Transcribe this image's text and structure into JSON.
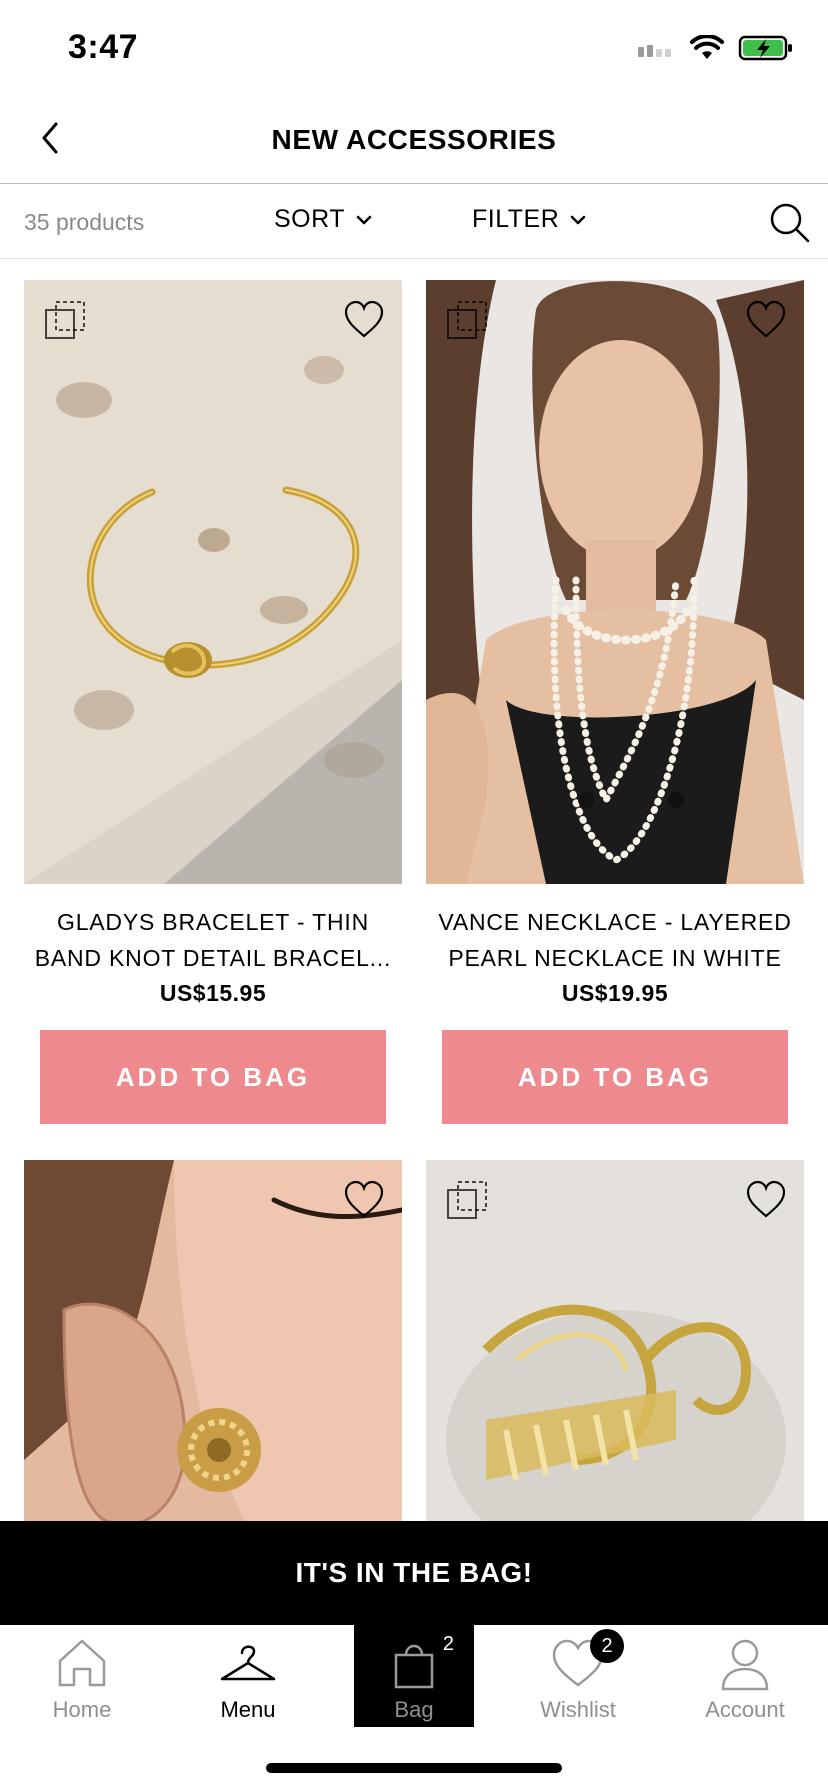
{
  "status_bar": {
    "time": "3:47"
  },
  "header": {
    "title": "NEW ACCESSORIES"
  },
  "toolbar": {
    "count": "35 products",
    "sort_label": "SORT",
    "filter_label": "FILTER"
  },
  "products": [
    {
      "name": "GLADYS BRACELET - THIN BAND KNOT DETAIL BRACEL...",
      "price": "US$15.95",
      "button": "ADD TO BAG"
    },
    {
      "name": "VANCE NECKLACE - LAYERED PEARL NECKLACE IN WHITE",
      "price": "US$19.95",
      "button": "ADD TO BAG"
    },
    {
      "name": "",
      "price": "",
      "button": ""
    },
    {
      "name": "",
      "price": "",
      "button": ""
    }
  ],
  "banner": {
    "text": "IT'S IN THE BAG!"
  },
  "nav": {
    "home": "Home",
    "menu": "Menu",
    "bag": "Bag",
    "bag_count": "2",
    "wishlist": "Wishlist",
    "wishlist_count": "2",
    "account": "Account"
  },
  "colors": {
    "accent": "#ee8a8e",
    "banner_bg": "#000000",
    "battery": "#3fbf4a"
  }
}
